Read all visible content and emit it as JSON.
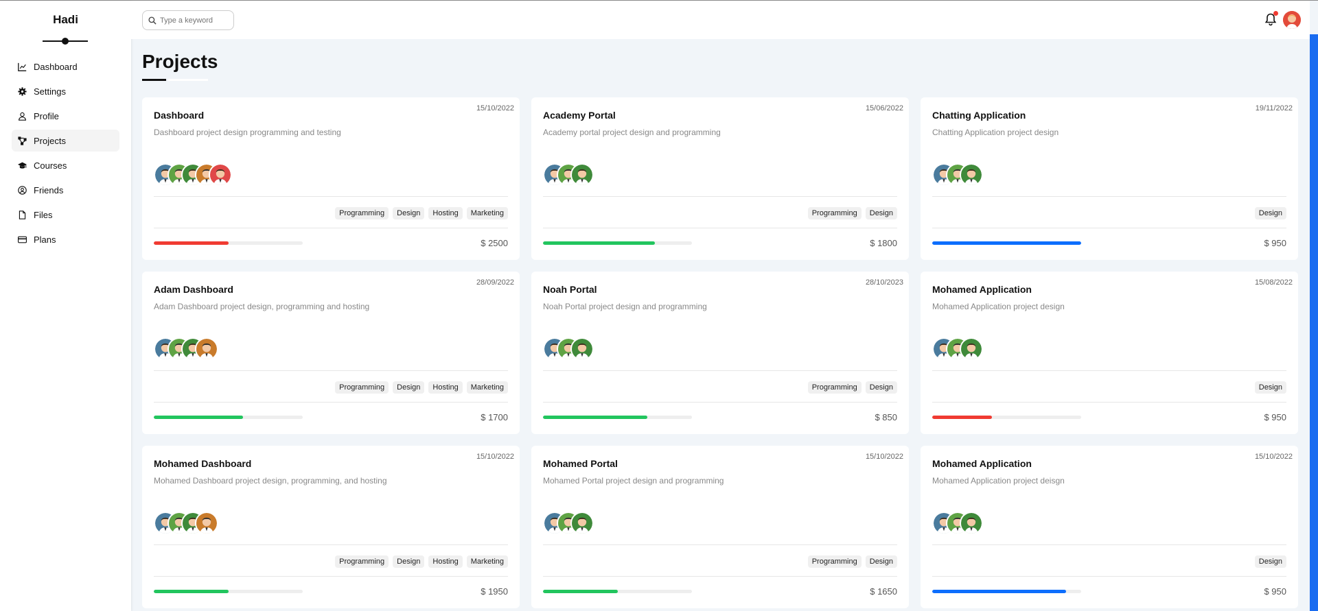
{
  "sidebar": {
    "brand": "Hadi",
    "items": [
      {
        "label": "Dashboard",
        "icon": "chart-icon"
      },
      {
        "label": "Settings",
        "icon": "gear-icon"
      },
      {
        "label": "Profile",
        "icon": "user-icon"
      },
      {
        "label": "Projects",
        "icon": "diagram-icon",
        "active": true
      },
      {
        "label": "Courses",
        "icon": "graduation-cap-icon"
      },
      {
        "label": "Friends",
        "icon": "circle-user-icon"
      },
      {
        "label": "Files",
        "icon": "file-icon"
      },
      {
        "label": "Plans",
        "icon": "credit-card-icon"
      }
    ]
  },
  "header": {
    "search_placeholder": "Type a keyword",
    "has_notification": true
  },
  "page": {
    "title": "Projects"
  },
  "colors": {
    "red": "#f03b32",
    "green": "#22c55e",
    "blue": "#0d6efd",
    "accent_bar": "#1a6cf0"
  },
  "projects": [
    {
      "date": "15/10/2022",
      "name": "Dashboard",
      "desc": "Dashboard project design programming and testing",
      "members": 5,
      "tags": [
        "Programming",
        "Design",
        "Hosting",
        "Marketing"
      ],
      "progress": 0.5,
      "color": "#f03b32",
      "price": "$ 2500"
    },
    {
      "date": "15/06/2022",
      "name": "Academy Portal",
      "desc": "Academy portal project design and programming",
      "members": 3,
      "tags": [
        "Programming",
        "Design"
      ],
      "progress": 0.75,
      "color": "#22c55e",
      "price": "$ 1800"
    },
    {
      "date": "19/11/2022",
      "name": "Chatting Application",
      "desc": "Chatting Application project design",
      "members": 3,
      "tags": [
        "Design"
      ],
      "progress": 1.0,
      "color": "#0d6efd",
      "price": "$ 950"
    },
    {
      "date": "28/09/2022",
      "name": "Adam Dashboard",
      "desc": "Adam Dashboard project design, programming and hosting",
      "members": 4,
      "tags": [
        "Programming",
        "Design",
        "Hosting",
        "Marketing"
      ],
      "progress": 0.6,
      "color": "#22c55e",
      "price": "$ 1700"
    },
    {
      "date": "28/10/2023",
      "name": "Noah Portal",
      "desc": "Noah Portal project design and programming",
      "members": 3,
      "tags": [
        "Programming",
        "Design"
      ],
      "progress": 0.7,
      "color": "#22c55e",
      "price": "$ 850"
    },
    {
      "date": "15/08/2022",
      "name": "Mohamed Application",
      "desc": "Mohamed Application project design",
      "members": 3,
      "tags": [
        "Design"
      ],
      "progress": 0.4,
      "color": "#f03b32",
      "price": "$ 950"
    },
    {
      "date": "15/10/2022",
      "name": "Mohamed Dashboard",
      "desc": "Mohamed Dashboard project design, programming, and hosting",
      "members": 4,
      "tags": [
        "Programming",
        "Design",
        "Hosting",
        "Marketing"
      ],
      "progress": 0.5,
      "color": "#22c55e",
      "price": "$ 1950"
    },
    {
      "date": "15/10/2022",
      "name": "Mohamed Portal",
      "desc": "Mohamed Portal project design and programming",
      "members": 3,
      "tags": [
        "Programming",
        "Design"
      ],
      "progress": 0.5,
      "color": "#22c55e",
      "price": "$ 1650"
    },
    {
      "date": "15/10/2022",
      "name": "Mohamed Application",
      "desc": "Mohamed Application project deisgn",
      "members": 3,
      "tags": [
        "Design"
      ],
      "progress": 0.9,
      "color": "#0d6efd",
      "price": "$ 950"
    }
  ]
}
